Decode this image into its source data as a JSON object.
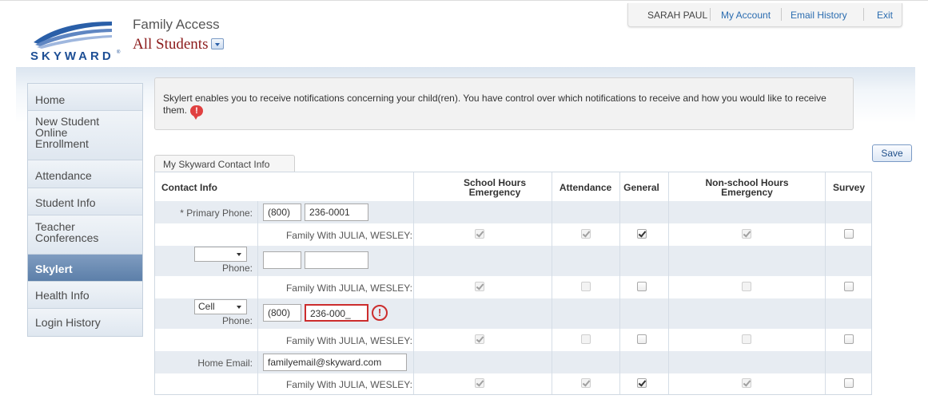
{
  "header": {
    "app_title": "Family Access",
    "student_selector": "All Students",
    "user_name": "SARAH PAUL",
    "links": [
      "My Account",
      "Email History",
      "Exit"
    ]
  },
  "sidebar": {
    "items": [
      {
        "label": "Home"
      },
      {
        "label": "New Student\nOnline\nEnrollment"
      },
      {
        "label": "Attendance"
      },
      {
        "label": "Student Info"
      },
      {
        "label": "Teacher\nConferences"
      },
      {
        "label": "Skylert",
        "active": true
      },
      {
        "label": "Health Info"
      },
      {
        "label": "Login History"
      }
    ]
  },
  "info_banner": "Skylert enables you to receive notifications concerning your child(ren). You have control over which notifications to receive and how you would like to receive them.",
  "tab_label": "My Skyward Contact Info",
  "save_label": "Save",
  "grid": {
    "headers": {
      "contact": "Contact Info",
      "school_emergency": "School Hours Emergency",
      "attendance": "Attendance",
      "general": "General",
      "nonschool_emergency": "Non-school Hours Emergency",
      "survey": "Survey"
    },
    "family_label": "Family With JULIA, WESLEY:",
    "primary_phone": {
      "label": "* Primary Phone:",
      "area": "(800)",
      "number": "236-0001"
    },
    "phone2": {
      "type": "",
      "label": "Phone:",
      "area": "",
      "number": ""
    },
    "cell_phone": {
      "type": "Cell",
      "label": "Phone:",
      "area": "(800)",
      "number": "236-000_"
    },
    "email": {
      "label": "Home Email:",
      "value": "familyemail@skyward.com"
    }
  },
  "colors": {
    "brand_blue": "#2a5fa8",
    "student_red": "#8b1a1a",
    "active_nav": "#6a8bb5",
    "error_red": "#cc2d2d"
  }
}
